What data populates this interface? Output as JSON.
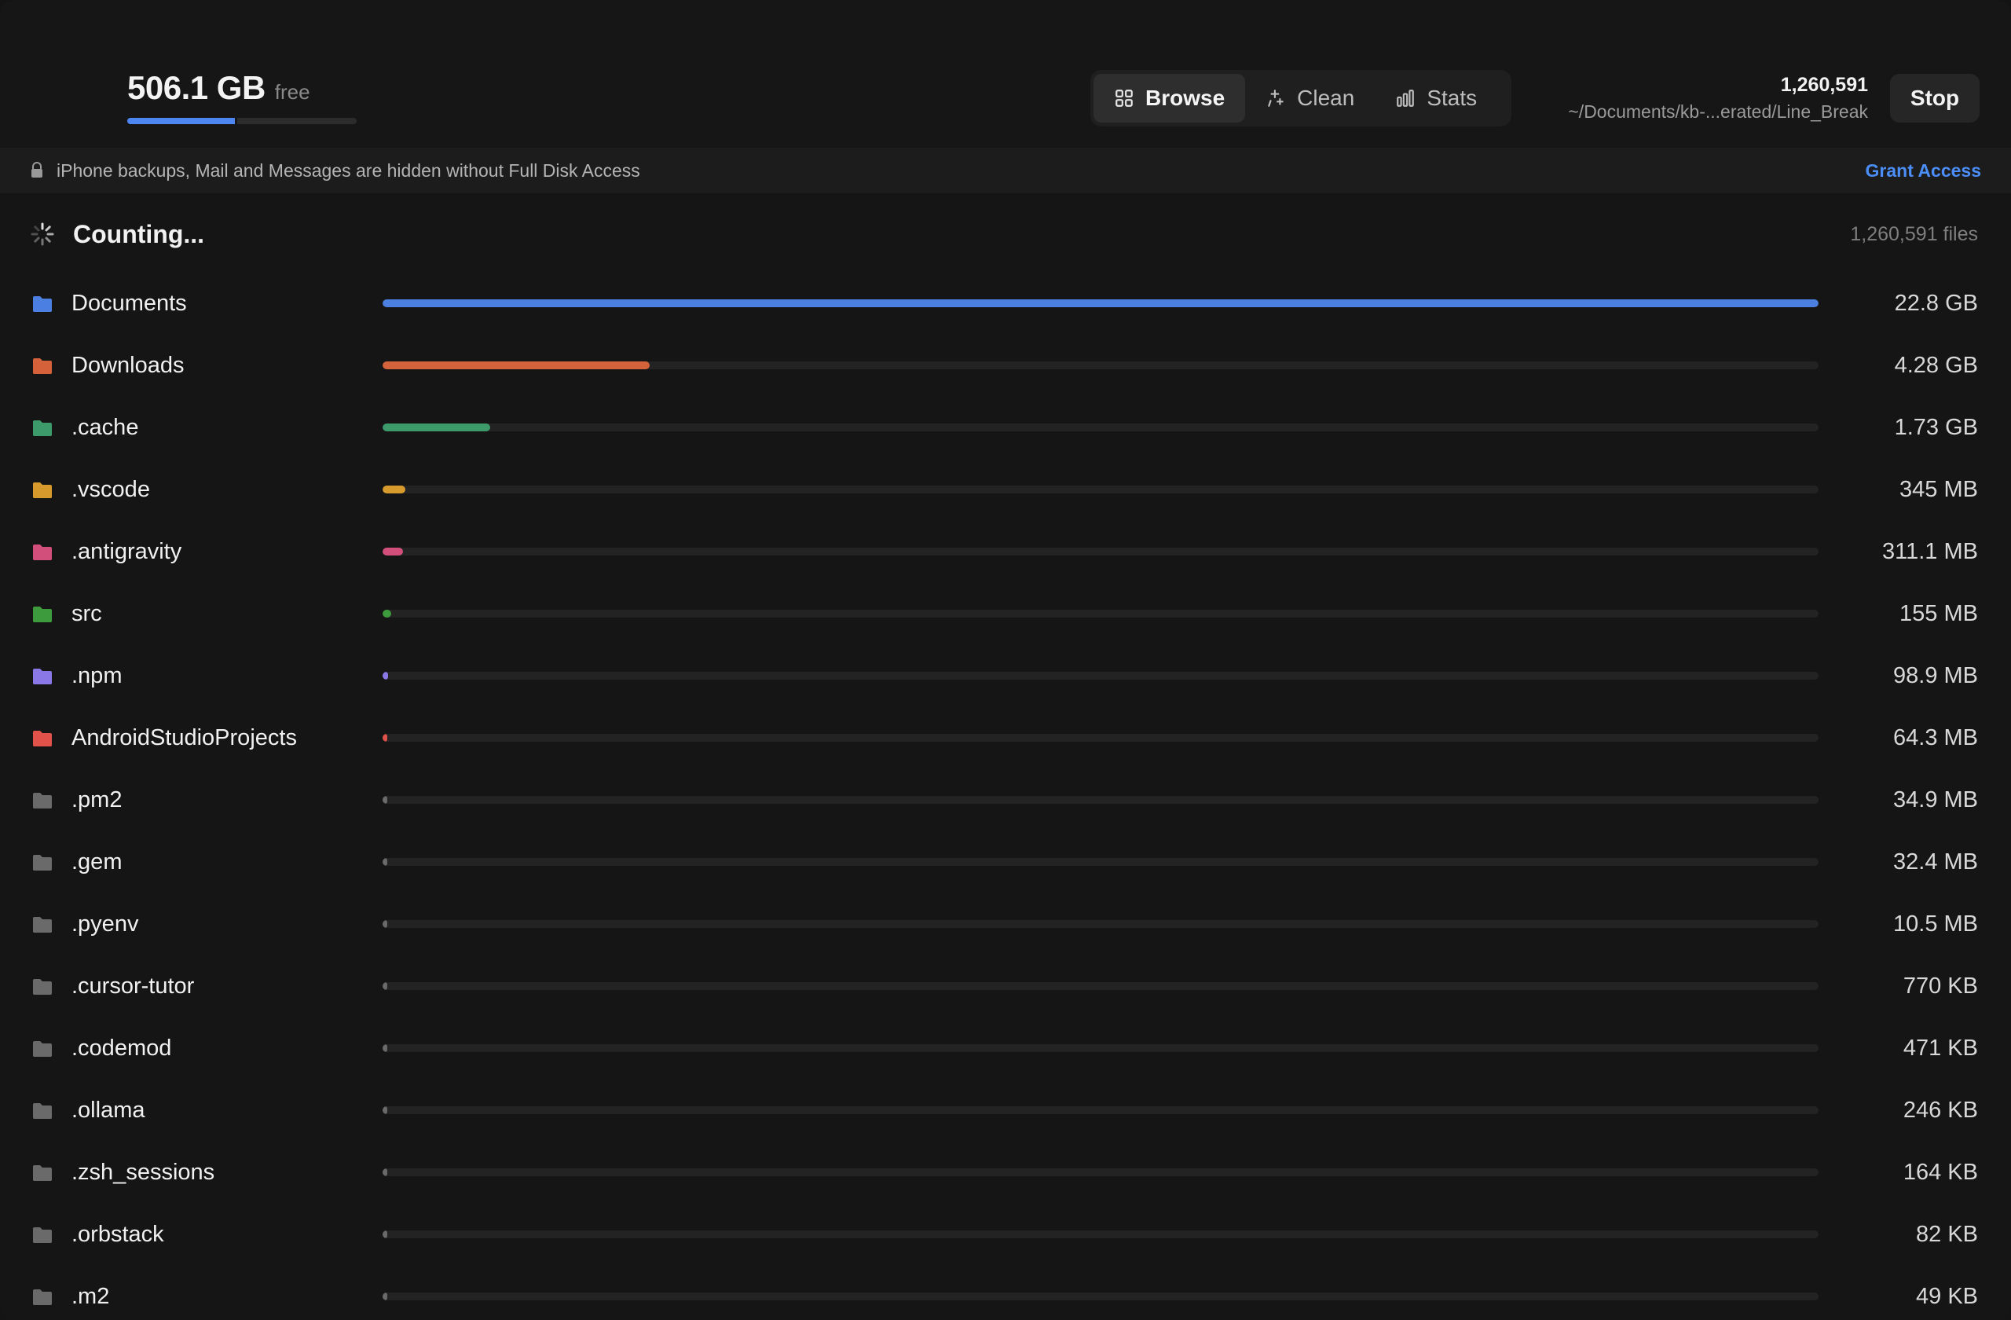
{
  "header": {
    "free_size": "506.1 GB",
    "free_label": "free",
    "disk_used_fraction": 0.48,
    "accent_color": "#4d86f0"
  },
  "tabs": [
    {
      "label": "Browse",
      "icon": "grid-icon",
      "active": true
    },
    {
      "label": "Clean",
      "icon": "sparkle-icon",
      "active": false
    },
    {
      "label": "Stats",
      "icon": "bar-chart-icon",
      "active": false
    }
  ],
  "scan": {
    "count": "1,260,591",
    "path": "~/Documents/kb-...erated/Line_Break",
    "stop_label": "Stop"
  },
  "banner": {
    "text": "iPhone backups, Mail and Messages are hidden without Full Disk Access",
    "link": "Grant Access",
    "icon": "lock-icon"
  },
  "status": {
    "text": "Counting...",
    "files": "1,260,591 files",
    "icon": "spinner-icon"
  },
  "rows": [
    {
      "name": "Documents",
      "size": "22.8 GB",
      "fraction": 1.0,
      "color": "#4b7fe0"
    },
    {
      "name": "Downloads",
      "size": "4.28 GB",
      "fraction": 0.186,
      "color": "#d4623a"
    },
    {
      "name": ".cache",
      "size": "1.73 GB",
      "fraction": 0.075,
      "color": "#3d9a6a"
    },
    {
      "name": ".vscode",
      "size": "345 MB",
      "fraction": 0.016,
      "color": "#d69a2d"
    },
    {
      "name": ".antigravity",
      "size": "311.1 MB",
      "fraction": 0.014,
      "color": "#d24f7c"
    },
    {
      "name": "src",
      "size": "155 MB",
      "fraction": 0.006,
      "color": "#3d9a3d"
    },
    {
      "name": ".npm",
      "size": "98.9 MB",
      "fraction": 0.004,
      "color": "#8a78e6"
    },
    {
      "name": "AndroidStudioProjects",
      "size": "64.3 MB",
      "fraction": 0.003,
      "color": "#e0524a"
    },
    {
      "name": ".pm2",
      "size": "34.9 MB",
      "fraction": 0.0015,
      "color": "#6a6a6a"
    },
    {
      "name": ".gem",
      "size": "32.4 MB",
      "fraction": 0.0014,
      "color": "#6a6a6a"
    },
    {
      "name": ".pyenv",
      "size": "10.5 MB",
      "fraction": 0.0005,
      "color": "#6a6a6a"
    },
    {
      "name": ".cursor-tutor",
      "size": "770 KB",
      "fraction": 0.0001,
      "color": "#6a6a6a"
    },
    {
      "name": ".codemod",
      "size": "471 KB",
      "fraction": 0.0001,
      "color": "#6a6a6a"
    },
    {
      "name": ".ollama",
      "size": "246 KB",
      "fraction": 0.0001,
      "color": "#6a6a6a"
    },
    {
      "name": ".zsh_sessions",
      "size": "164 KB",
      "fraction": 0.0001,
      "color": "#6a6a6a"
    },
    {
      "name": ".orbstack",
      "size": "82 KB",
      "fraction": 0.0001,
      "color": "#6a6a6a"
    },
    {
      "name": ".m2",
      "size": "49 KB",
      "fraction": 0.0001,
      "color": "#6a6a6a"
    }
  ]
}
